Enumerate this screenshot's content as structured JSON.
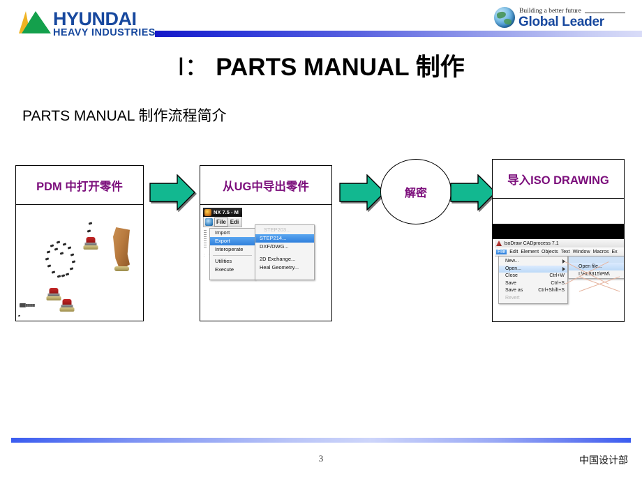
{
  "header": {
    "brand_name": "HYUNDAI",
    "brand_sub": "HEAVY INDUSTRIES",
    "brand_color": "#17489e",
    "triangle_green": "#14a04c",
    "triangle_gold": "#f0b323",
    "tagline": "Building a better future",
    "slogan": "Global Leader",
    "globe_icon": "globe-icon"
  },
  "title": {
    "numeral": "Ⅰ：",
    "main": " PARTS MANUAL ",
    "suffix": "制作"
  },
  "subtitle": "PARTS MANUAL 制作流程简介",
  "accent_purple": "#7b0d7b",
  "arrow_color": "#12b890",
  "flow": {
    "step1": {
      "label": "PDM  中打开零件",
      "screenshot": "cad-assembly-parts"
    },
    "step2": {
      "label": "从UG中导出零件",
      "screenshot": "nx-export-menu",
      "nx": {
        "window_title": "NX 7.5 - M",
        "toolbar": {
          "file": "File",
          "edit": "Edi"
        },
        "menu_items": [
          "Import",
          "Export",
          "Interoperate",
          "Utilities",
          "Execute"
        ],
        "selected_menu": "Export",
        "submenu_items": [
          "STEP214...",
          "DXF/DWG...",
          "2D Exchange...",
          "Heal Geometry..."
        ],
        "selected_submenu": "STEP214...",
        "ghost_item": "STEP203..."
      }
    },
    "step3": {
      "label": "解密"
    },
    "step4": {
      "label": "导入ISO DRAWING",
      "screenshot": "isodraw-file-menu",
      "iso": {
        "app_title": "IsoDraw CADprocess 7.1",
        "menubar": [
          "File",
          "Edit",
          "Element",
          "Objects",
          "Text",
          "Window",
          "Macros",
          "Ex"
        ],
        "active_menu": "File",
        "menu_items": [
          {
            "label": "New...",
            "shortcut": "",
            "submenu": true,
            "state": "normal"
          },
          {
            "label": "Open...",
            "shortcut": "",
            "submenu": true,
            "state": "highlight"
          },
          {
            "label": "Close",
            "shortcut": "Ctrl+W",
            "submenu": false,
            "state": "normal"
          },
          {
            "label": "Save",
            "shortcut": "Ctrl+S",
            "submenu": false,
            "state": "normal"
          },
          {
            "label": "Save as",
            "shortcut": "Ctrl+Shift+S",
            "submenu": false,
            "state": "normal"
          },
          {
            "label": "Revert",
            "shortcut": "",
            "submenu": false,
            "state": "disabled"
          }
        ],
        "submenu_items": [
          "Open file...",
          "I:\\HL8315\\PM\\"
        ],
        "selected_submenu": "Open file..."
      }
    }
  },
  "footer": {
    "page_number": "3",
    "department": "中国设计部"
  }
}
